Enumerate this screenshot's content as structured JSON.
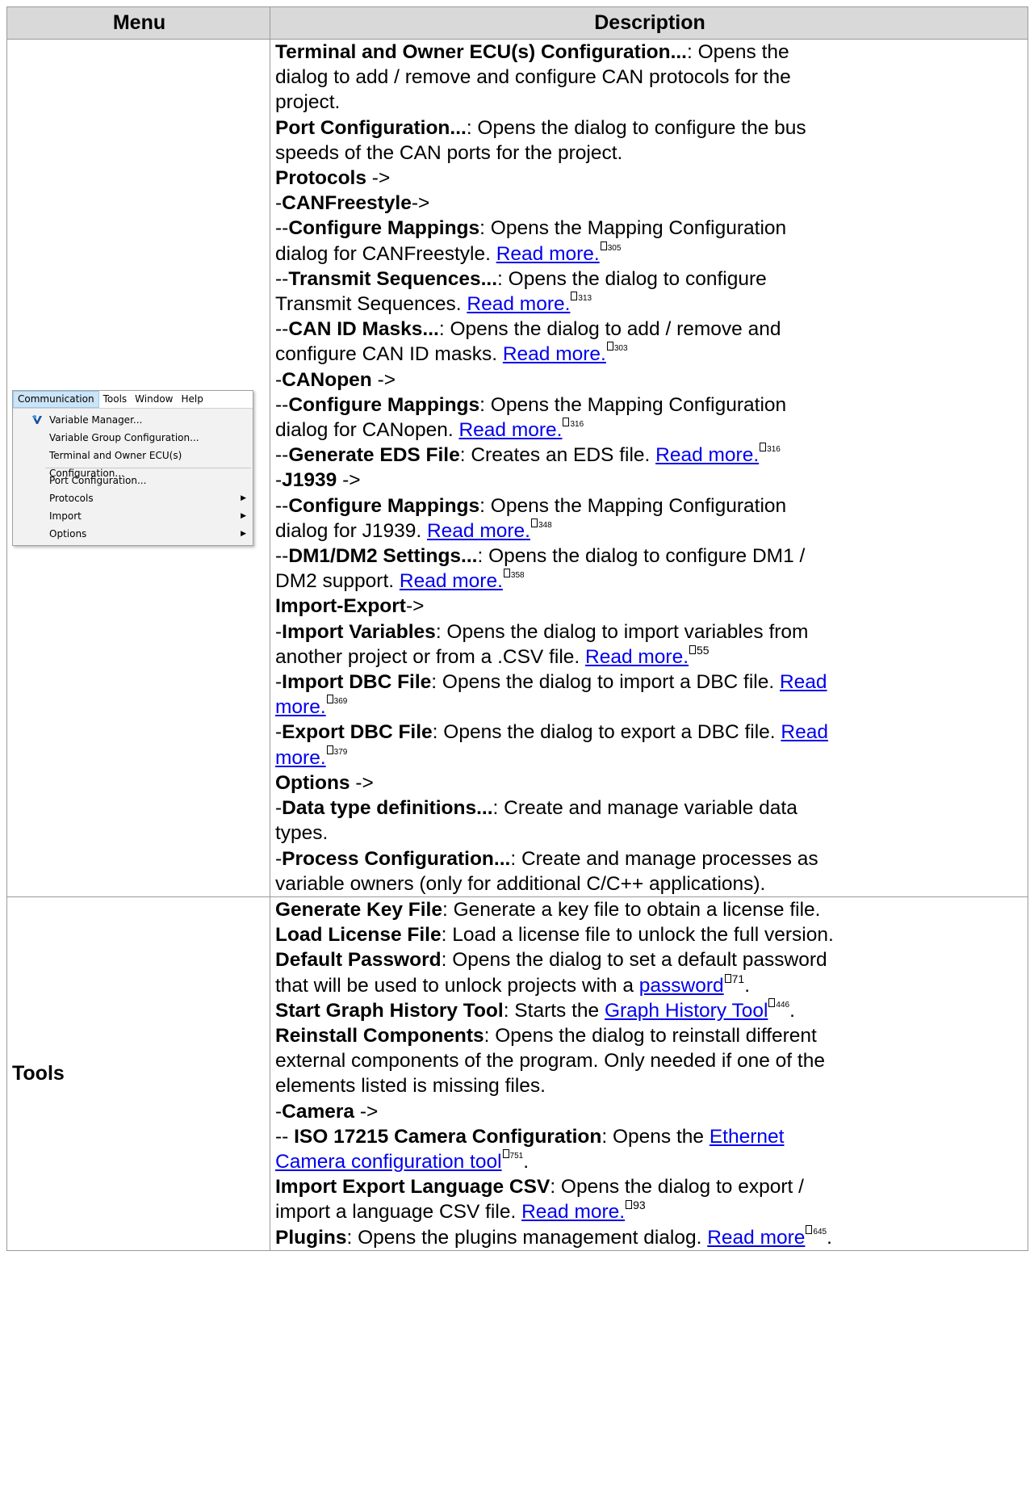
{
  "table": {
    "headers": [
      "Menu",
      "Description"
    ]
  },
  "menu_screenshot": {
    "menubar": [
      "Communication",
      "Tools",
      "Window",
      "Help"
    ],
    "items": [
      "Variable Manager...",
      "Variable Group Configuration...",
      "Terminal and Owner ECU(s) Configuration...",
      "Port Configuration...",
      "Protocols",
      "Import",
      "Options"
    ]
  },
  "row1": {
    "l01_b": "Terminal and Owner ECU(s) Configuration...",
    "l01_t": ": Opens the",
    "l02": "dialog to add / remove and configure CAN protocols for the",
    "l03": "project.",
    "l04_b": "Port Configuration...",
    "l04_t": ": Opens the dialog to configure the bus",
    "l05": "speeds of the CAN ports for the project.",
    "l06_b": "Protocols",
    "l06_t": " ->",
    "l07_p": "-",
    "l07_b": "CANFreestyle",
    "l07_t": "->",
    "l08_p": "--",
    "l08_b": "Configure Mappings",
    "l08_t": ": Opens the Mapping Configuration",
    "l09_t": "dialog for CANFreestyle. ",
    "l09_a": "Read more.",
    "l09_pg": "305",
    "l10_p": "--",
    "l10_b": "Transmit Sequences...",
    "l10_t": ": Opens the dialog to configure",
    "l11_t": "Transmit Sequences. ",
    "l11_a": "Read more.",
    "l11_pg": "313",
    "l12_p": "--",
    "l12_b": "CAN ID Masks...",
    "l12_t": ": Opens the dialog to add / remove and",
    "l13_t": "configure CAN ID masks. ",
    "l13_a": "Read more.",
    "l13_pg": "303",
    "l14_p": "-",
    "l14_b": "CANopen",
    "l14_t": " ->",
    "l15_p": "--",
    "l15_b": "Configure Mappings",
    "l15_t": ": Opens the Mapping Configuration",
    "l16_t": "dialog for CANopen. ",
    "l16_a": "Read more.",
    "l16_pg": "316",
    "l17_p": "--",
    "l17_b": "Generate EDS File",
    "l17_t": ": Creates an EDS file. ",
    "l17_a": "Read more.",
    "l17_pg": "316",
    "l18_p": "-",
    "l18_b": "J1939",
    "l18_t": " ->",
    "l19_p": "--",
    "l19_b": "Configure Mappings",
    "l19_t": ": Opens the Mapping Configuration",
    "l20_t": "dialog for J1939. ",
    "l20_a": "Read more.",
    "l20_pg": "348",
    "l21_p": "--",
    "l21_b": "DM1/DM2 Settings...",
    "l21_t": ": Opens the dialog to configure DM1 /",
    "l22_t": "DM2 support. ",
    "l22_a": "Read more.",
    "l22_pg": "358",
    "l23_b": "Import-Export",
    "l23_t": "->",
    "l24_p": "-",
    "l24_b": "Import Variables",
    "l24_t": ": Opens the dialog to import variables from",
    "l25_t": "another project or from a .CSV file. ",
    "l25_a": "Read more.",
    "l25_pg": "55",
    "l26_p": "-",
    "l26_b": "Import DBC File",
    "l26_t": ": Opens the dialog to import a DBC file. ",
    "l26_a": "Read",
    "l27_a": "more.",
    "l27_pg": "369",
    "l28_p": "-",
    "l28_b": "Export DBC File",
    "l28_t": ": Opens the dialog to export a DBC file. ",
    "l28_a": "Read",
    "l29_a": "more.",
    "l29_pg": "379",
    "l30_b": "Options",
    "l30_t": " ->",
    "l31_p": "-",
    "l31_b": "Data type definitions...",
    "l31_t": ": Create and manage variable data",
    "l32": "types.",
    "l33_p": "-",
    "l33_b": "Process Configuration...",
    "l33_t": ": Create and manage processes as",
    "l34": "variable owners (only for additional C/C++ applications)."
  },
  "row2": {
    "menu_label": "Tools",
    "l01_b": "Generate Key File",
    "l01_t": ": Generate a key file to obtain a license file.",
    "l02_b": "Load License File",
    "l02_t": ": Load a license file to unlock the full version.",
    "l03_b": "Default Password",
    "l03_t": ": Opens the dialog to set a default password",
    "l04_t": "that will be used to unlock projects with a ",
    "l04_a": "password",
    "l04_pg": "71",
    "l04_e": ".",
    "l05_b": "Start Graph History Tool",
    "l05_t": ": Starts the ",
    "l05_a": "Graph History Tool",
    "l05_pg": "446",
    "l05_e": ".",
    "l06_b": "Reinstall Components",
    "l06_t": ": Opens the dialog to reinstall different",
    "l07": "external components of the program. Only needed if one of the",
    "l08": "elements listed is missing files.",
    "l09_p": "-",
    "l09_b": "Camera",
    "l09_t": " ->",
    "l10_p": "-- ",
    "l10_b": "ISO 17215 Camera Configuration",
    "l10_t": ": Opens the ",
    "l10_a": "Ethernet",
    "l11_a": "Camera configuration tool",
    "l11_pg": "751",
    "l11_e": ".",
    "l12_b": "Import Export Language CSV",
    "l12_t": ": Opens the dialog to export /",
    "l13_t": "import a language CSV file. ",
    "l13_a": "Read more.",
    "l13_pg": "93",
    "l14_b": "Plugins",
    "l14_t": ": Opens the plugins management dialog. ",
    "l14_a": "Read more",
    "l14_pg": "645",
    "l14_e": "."
  }
}
